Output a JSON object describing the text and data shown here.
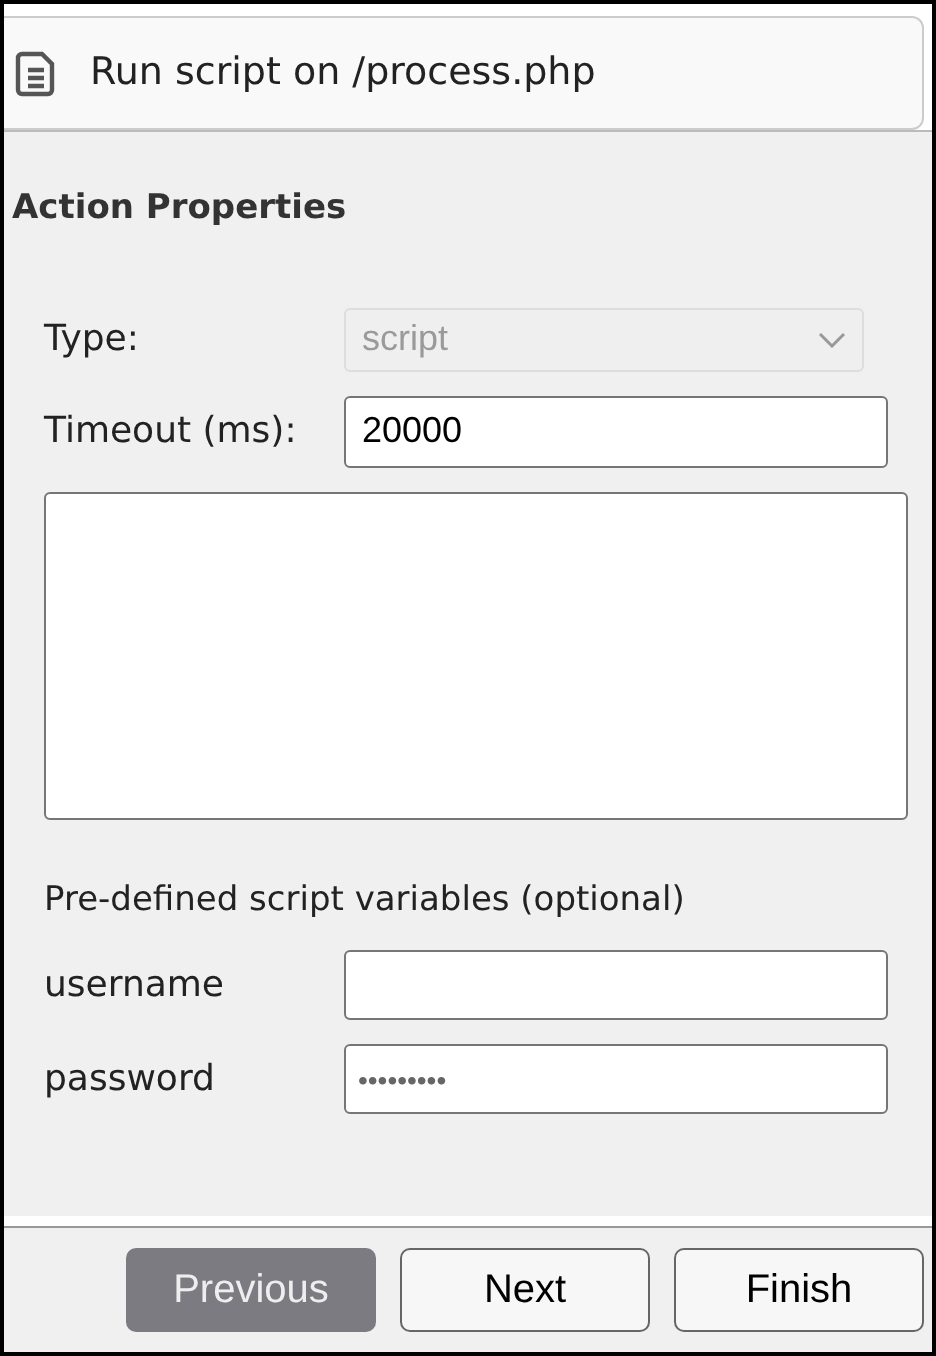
{
  "header": {
    "title": "Run script on /process.php"
  },
  "section": {
    "title": "Action Properties"
  },
  "fields": [
    {
      "kind": "select",
      "label": "Type:",
      "value": "script",
      "disabled": true
    },
    {
      "kind": "text",
      "label": "Timeout (ms):",
      "value": "20000",
      "disabled": false
    },
    {
      "kind": "textarea"
    }
  ],
  "variables": {
    "title": "Pre-defined script variables (optional)",
    "items": [
      {
        "label": "username",
        "value": ""
      },
      {
        "label": "password",
        "value": "•••••••••"
      }
    ]
  },
  "buttons": [
    {
      "label": "Previous",
      "disabled": true
    },
    {
      "label": "Next",
      "disabled": false
    },
    {
      "label": "Finish",
      "disabled": false
    }
  ]
}
